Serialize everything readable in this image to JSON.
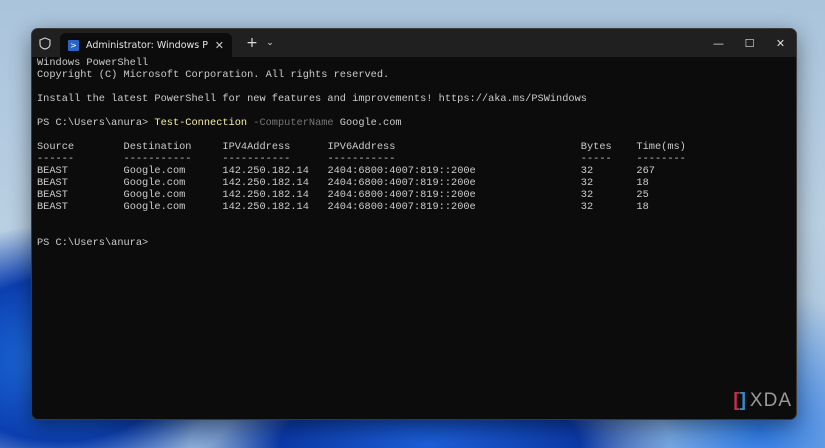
{
  "window": {
    "tab_title": "Administrator: Windows PowerShell",
    "new_tab": "+",
    "dropdown": "⌄",
    "minimize": "—",
    "maximize": "☐",
    "close": "✕",
    "tab_close": "✕"
  },
  "console": {
    "banner": [
      "Windows PowerShell",
      "Copyright (C) Microsoft Corporation. All rights reserved."
    ],
    "install": "Install the latest PowerShell for new features and improvements! https://aka.ms/PSWindows",
    "prompt": "PS C:\\Users\\anura> ",
    "command": "Test-Connection",
    "param": " -ComputerName",
    "arg": " Google.com",
    "table": {
      "headers": [
        "Source",
        "Destination",
        "IPV4Address",
        "IPV6Address",
        "Bytes",
        "Time(ms)"
      ],
      "rows": [
        [
          "BEAST",
          "Google.com",
          "142.250.182.14",
          "2404:6800:4007:819::200e",
          "32",
          "267"
        ],
        [
          "BEAST",
          "Google.com",
          "142.250.182.14",
          "2404:6800:4007:819::200e",
          "32",
          "18"
        ],
        [
          "BEAST",
          "Google.com",
          "142.250.182.14",
          "2404:6800:4007:819::200e",
          "32",
          "25"
        ],
        [
          "BEAST",
          "Google.com",
          "142.250.182.14",
          "2404:6800:4007:819::200e",
          "32",
          "18"
        ]
      ]
    },
    "final_prompt": "PS C:\\Users\\anura>"
  },
  "watermark": "XDA"
}
